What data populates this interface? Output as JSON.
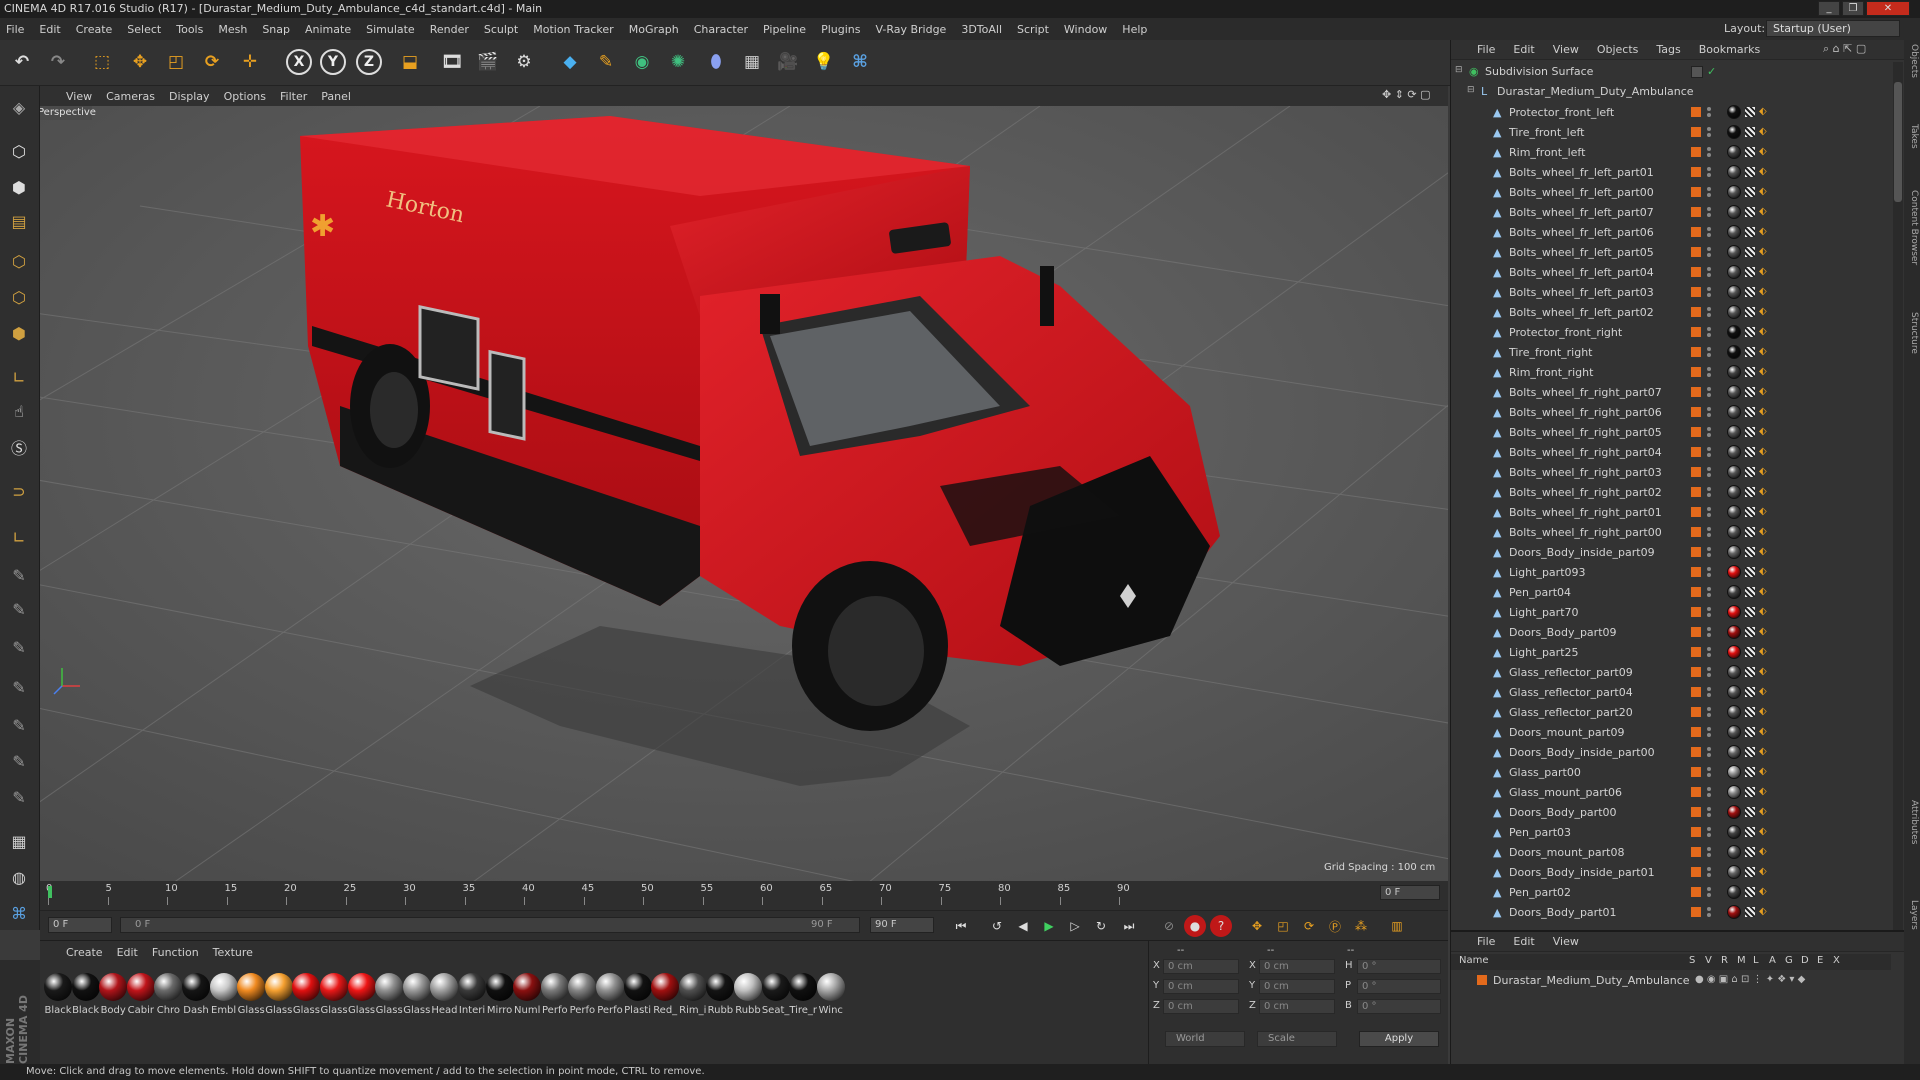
{
  "window": {
    "title": "CINEMA 4D R17.016 Studio (R17) - [Durastar_Medium_Duty_Ambulance_c4d_standart.c4d] - Main",
    "controls": [
      "_",
      "❐",
      "✕"
    ]
  },
  "menu": [
    "File",
    "Edit",
    "Create",
    "Select",
    "Tools",
    "Mesh",
    "Snap",
    "Animate",
    "Simulate",
    "Render",
    "Sculpt",
    "Motion Tracker",
    "MoGraph",
    "Character",
    "Pipeline",
    "Plugins",
    "V-Ray Bridge",
    "3DToAll",
    "Script",
    "Window",
    "Help"
  ],
  "layout": {
    "label": "Layout:",
    "value": "Startup (User)"
  },
  "toolbar": {
    "axis_x": "X",
    "axis_y": "Y",
    "axis_z": "Z"
  },
  "viewport": {
    "menu": [
      "View",
      "Cameras",
      "Display",
      "Options",
      "Filter",
      "Panel"
    ],
    "camera_label": "Perspective",
    "grid_spacing": "Grid Spacing : 100 cm",
    "vehicle_text": "Horton"
  },
  "timeline": {
    "ticks": [
      "0",
      "5",
      "10",
      "15",
      "20",
      "25",
      "30",
      "35",
      "40",
      "45",
      "50",
      "55",
      "60",
      "65",
      "70",
      "75",
      "80",
      "85",
      "90"
    ],
    "frame_end_field": "0 F",
    "current_frame": "0 F",
    "range_start": "0 F",
    "range_end": "90 F",
    "max_frame": "90 F"
  },
  "materials": {
    "menu": [
      "Create",
      "Edit",
      "Function",
      "Texture"
    ],
    "items": [
      {
        "label": "Black",
        "color": "#1a1a1a"
      },
      {
        "label": "Black",
        "color": "#111111"
      },
      {
        "label": "Body",
        "color": "#b0141a"
      },
      {
        "label": "Cabir",
        "color": "#c0141a"
      },
      {
        "label": "Chro",
        "color": "#6a6a6a"
      },
      {
        "label": "Dash",
        "color": "#151515"
      },
      {
        "label": "Embl",
        "color": "#c8c8c8"
      },
      {
        "label": "Glass",
        "color": "#f08a20"
      },
      {
        "label": "Glass",
        "color": "#f5a030"
      },
      {
        "label": "Glass",
        "color": "#e01010"
      },
      {
        "label": "Glass",
        "color": "#e81818"
      },
      {
        "label": "Glass",
        "color": "#ee1515"
      },
      {
        "label": "Glass",
        "color": "#909090"
      },
      {
        "label": "Glass",
        "color": "#9a9a9a"
      },
      {
        "label": "Head",
        "color": "#a0a0a0"
      },
      {
        "label": "Interi",
        "color": "#3a3a3a"
      },
      {
        "label": "Mirro",
        "color": "#101010"
      },
      {
        "label": "Numl",
        "color": "#8a1010"
      },
      {
        "label": "Perfo",
        "color": "#7a7a7a"
      },
      {
        "label": "Perfo",
        "color": "#858585"
      },
      {
        "label": "Perfo",
        "color": "#909090"
      },
      {
        "label": "Plasti",
        "color": "#121212"
      },
      {
        "label": "Red_",
        "color": "#a01010"
      },
      {
        "label": "Rim_i",
        "color": "#505050"
      },
      {
        "label": "Rubb",
        "color": "#141414"
      },
      {
        "label": "Rubb",
        "color": "#c0c0c0"
      },
      {
        "label": "Seat_",
        "color": "#1a1a1a"
      },
      {
        "label": "Tire_r",
        "color": "#101010"
      },
      {
        "label": "Winc",
        "color": "#a8a8a8"
      }
    ]
  },
  "coordinates": {
    "header_dashes": [
      "--",
      "--",
      "--"
    ],
    "rows": [
      {
        "a": "X",
        "av": "0 cm",
        "b": "X",
        "bv": "0 cm",
        "c": "H",
        "cv": "0 °"
      },
      {
        "a": "Y",
        "av": "0 cm",
        "b": "Y",
        "bv": "0 cm",
        "c": "P",
        "cv": "0 °"
      },
      {
        "a": "Z",
        "av": "0 cm",
        "b": "Z",
        "bv": "0 cm",
        "c": "B",
        "cv": "0 °"
      }
    ],
    "mode": "World",
    "scale": "Scale",
    "apply": "Apply"
  },
  "objects": {
    "menu": [
      "File",
      "Edit",
      "View",
      "Objects",
      "Tags",
      "Bookmarks"
    ],
    "root": "Subdivision Surface",
    "group": "Durastar_Medium_Duty_Ambulance",
    "items": [
      {
        "name": "Protector_front_left",
        "mat": "#111111"
      },
      {
        "name": "Tire_front_left",
        "mat": "#111111"
      },
      {
        "name": "Rim_front_left",
        "mat": "#444444"
      },
      {
        "name": "Bolts_wheel_fr_left_part01",
        "mat": "#555555"
      },
      {
        "name": "Bolts_wheel_fr_left_part00",
        "mat": "#555555"
      },
      {
        "name": "Bolts_wheel_fr_left_part07",
        "mat": "#555555"
      },
      {
        "name": "Bolts_wheel_fr_left_part06",
        "mat": "#555555"
      },
      {
        "name": "Bolts_wheel_fr_left_part05",
        "mat": "#555555"
      },
      {
        "name": "Bolts_wheel_fr_left_part04",
        "mat": "#555555"
      },
      {
        "name": "Bolts_wheel_fr_left_part03",
        "mat": "#555555"
      },
      {
        "name": "Bolts_wheel_fr_left_part02",
        "mat": "#555555"
      },
      {
        "name": "Protector_front_right",
        "mat": "#111111"
      },
      {
        "name": "Tire_front_right",
        "mat": "#111111"
      },
      {
        "name": "Rim_front_right",
        "mat": "#444444"
      },
      {
        "name": "Bolts_wheel_fr_right_part07",
        "mat": "#555555"
      },
      {
        "name": "Bolts_wheel_fr_right_part06",
        "mat": "#555555"
      },
      {
        "name": "Bolts_wheel_fr_right_part05",
        "mat": "#555555"
      },
      {
        "name": "Bolts_wheel_fr_right_part04",
        "mat": "#555555"
      },
      {
        "name": "Bolts_wheel_fr_right_part03",
        "mat": "#555555"
      },
      {
        "name": "Bolts_wheel_fr_right_part02",
        "mat": "#555555"
      },
      {
        "name": "Bolts_wheel_fr_right_part01",
        "mat": "#555555"
      },
      {
        "name": "Bolts_wheel_fr_right_part00",
        "mat": "#555555"
      },
      {
        "name": "Doors_Body_inside_part09",
        "mat": "#666666"
      },
      {
        "name": "Light_part093",
        "mat": "#e01010"
      },
      {
        "name": "Pen_part04",
        "mat": "#444444"
      },
      {
        "name": "Light_part70",
        "mat": "#e01010"
      },
      {
        "name": "Doors_Body_part09",
        "mat": "#a01010"
      },
      {
        "name": "Light_part25",
        "mat": "#e01010"
      },
      {
        "name": "Glass_reflector_part09",
        "mat": "#555555"
      },
      {
        "name": "Glass_reflector_part04",
        "mat": "#555555"
      },
      {
        "name": "Glass_reflector_part20",
        "mat": "#555555"
      },
      {
        "name": "Doors_mount_part09",
        "mat": "#555555"
      },
      {
        "name": "Doors_Body_inside_part00",
        "mat": "#666666"
      },
      {
        "name": "Glass_part00",
        "mat": "#999999"
      },
      {
        "name": "Glass_mount_part06",
        "mat": "#888888"
      },
      {
        "name": "Doors_Body_part00",
        "mat": "#a01010"
      },
      {
        "name": "Pen_part03",
        "mat": "#444444"
      },
      {
        "name": "Doors_mount_part08",
        "mat": "#555555"
      },
      {
        "name": "Doors_Body_inside_part01",
        "mat": "#666666"
      },
      {
        "name": "Pen_part02",
        "mat": "#444444"
      },
      {
        "name": "Doors_Body_part01",
        "mat": "#a01010"
      }
    ]
  },
  "attributes": {
    "menu": [
      "File",
      "Edit",
      "View"
    ],
    "columns": [
      "Name",
      "S",
      "V",
      "R",
      "M",
      "L",
      "A",
      "G",
      "D",
      "E",
      "X"
    ],
    "row": "Durastar_Medium_Duty_Ambulance"
  },
  "side_tabs": [
    "Objects",
    "Takes",
    "Content Browser",
    "Structure",
    "Attributes",
    "Layers"
  ],
  "brand": "MAXON CINEMA 4D",
  "status": "Move: Click and drag to move elements. Hold down SHIFT to quantize movement / add to the selection in point mode, CTRL to remove."
}
